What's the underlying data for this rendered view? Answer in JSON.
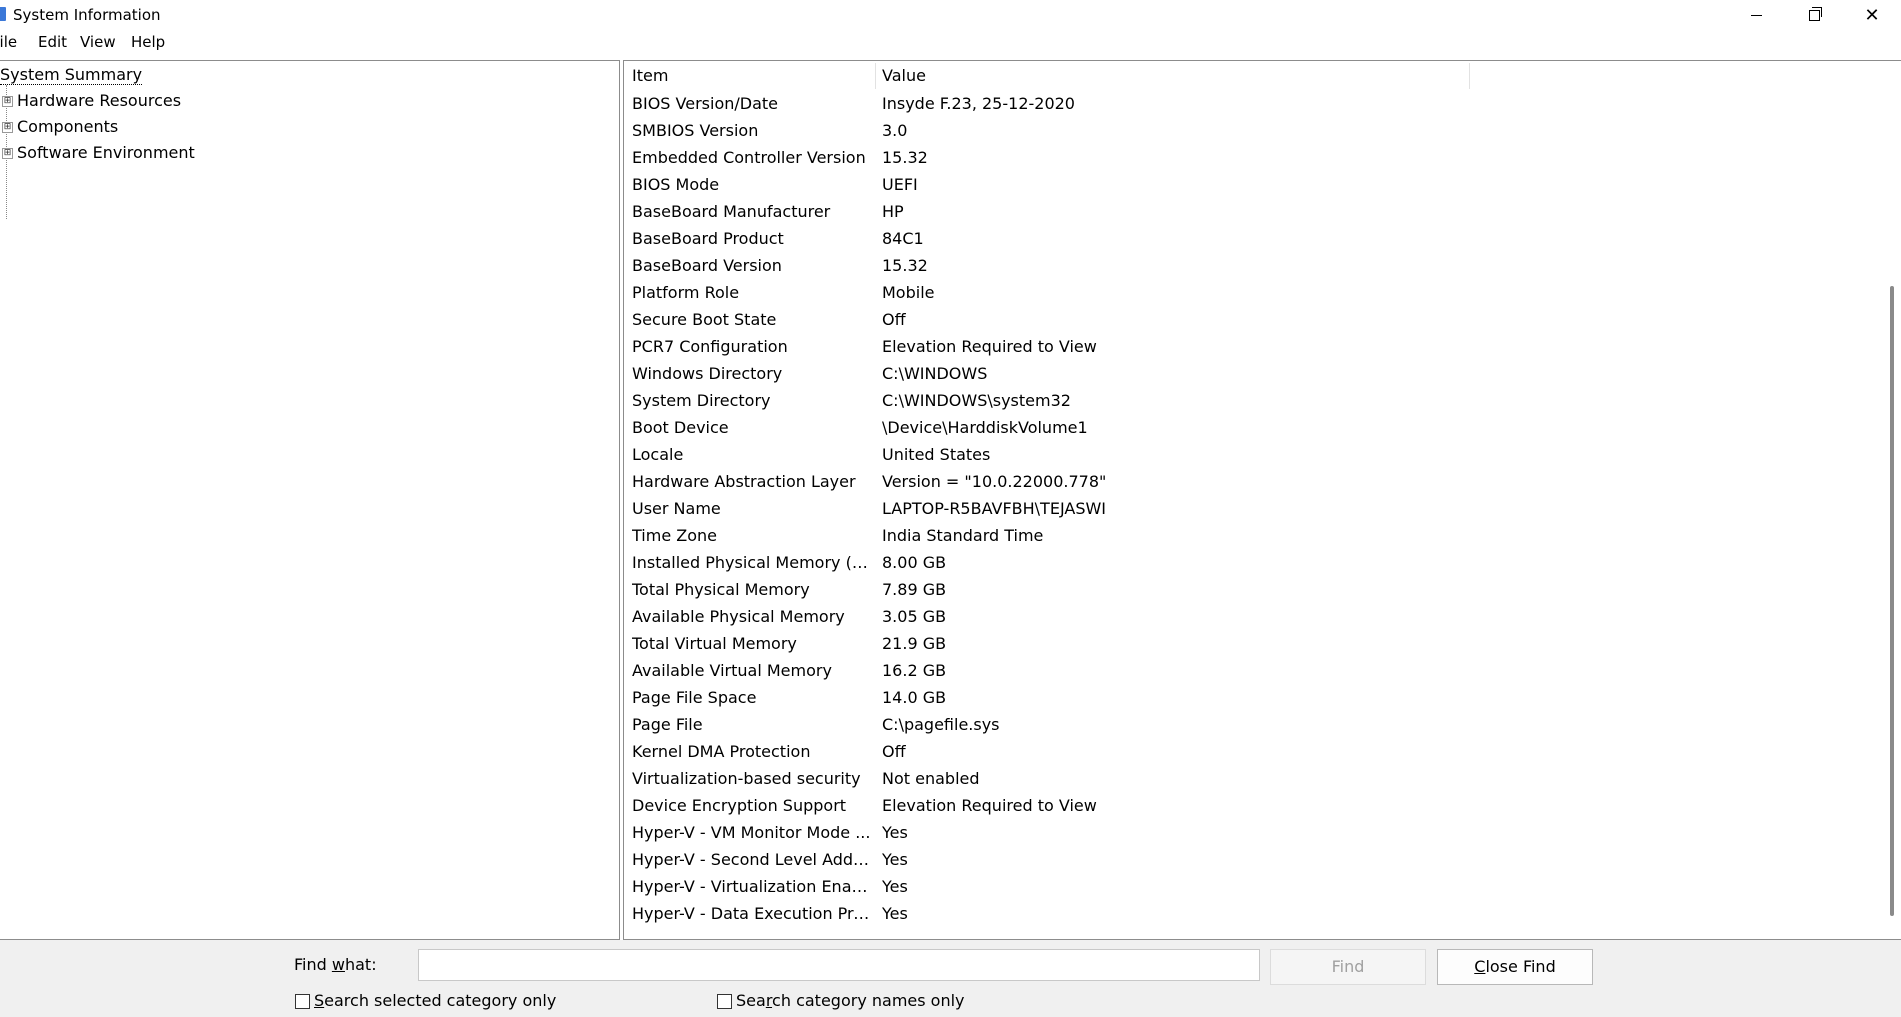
{
  "window": {
    "title": "System Information",
    "icon": "system-information-icon",
    "controls": {
      "minimize": "minimize-icon",
      "maximize": "restore-icon",
      "close_glyph": "✕"
    }
  },
  "menu": {
    "file": "File",
    "edit": "Edit",
    "view": "View",
    "help": "Help"
  },
  "tree": {
    "root": "System Summary",
    "nodes": [
      {
        "label": "Hardware Resources",
        "expander": "⊞"
      },
      {
        "label": "Components",
        "expander": "⊞"
      },
      {
        "label": "Software Environment",
        "expander": "⊞"
      }
    ]
  },
  "list": {
    "columns": {
      "item": "Item",
      "value": "Value"
    },
    "rows": [
      {
        "item": "BIOS Version/Date",
        "value": "Insyde F.23, 25-12-2020"
      },
      {
        "item": "SMBIOS Version",
        "value": "3.0"
      },
      {
        "item": "Embedded Controller Version",
        "value": "15.32"
      },
      {
        "item": "BIOS Mode",
        "value": "UEFI"
      },
      {
        "item": "BaseBoard Manufacturer",
        "value": "HP"
      },
      {
        "item": "BaseBoard Product",
        "value": "84C1"
      },
      {
        "item": "BaseBoard Version",
        "value": "15.32"
      },
      {
        "item": "Platform Role",
        "value": "Mobile"
      },
      {
        "item": "Secure Boot State",
        "value": "Off"
      },
      {
        "item": "PCR7 Configuration",
        "value": "Elevation Required to View"
      },
      {
        "item": "Windows Directory",
        "value": "C:\\WINDOWS"
      },
      {
        "item": "System Directory",
        "value": "C:\\WINDOWS\\system32"
      },
      {
        "item": "Boot Device",
        "value": "\\Device\\HarddiskVolume1"
      },
      {
        "item": "Locale",
        "value": "United States"
      },
      {
        "item": "Hardware Abstraction Layer",
        "value": "Version = \"10.0.22000.778\""
      },
      {
        "item": "User Name",
        "value": "LAPTOP-R5BAVFBH\\TEJASWI"
      },
      {
        "item": "Time Zone",
        "value": "India Standard Time"
      },
      {
        "item": "Installed Physical Memory (RA...",
        "value": "8.00 GB"
      },
      {
        "item": "Total Physical Memory",
        "value": "7.89 GB"
      },
      {
        "item": "Available Physical Memory",
        "value": "3.05 GB"
      },
      {
        "item": "Total Virtual Memory",
        "value": "21.9 GB"
      },
      {
        "item": "Available Virtual Memory",
        "value": "16.2 GB"
      },
      {
        "item": "Page File Space",
        "value": "14.0 GB"
      },
      {
        "item": "Page File",
        "value": "C:\\pagefile.sys"
      },
      {
        "item": "Kernel DMA Protection",
        "value": "Off"
      },
      {
        "item": "Virtualization-based security",
        "value": "Not enabled"
      },
      {
        "item": "Device Encryption Support",
        "value": "Elevation Required to View"
      },
      {
        "item": "Hyper-V - VM Monitor Mode ...",
        "value": "Yes"
      },
      {
        "item": "Hyper-V - Second Level Addre...",
        "value": "Yes"
      },
      {
        "item": "Hyper-V - Virtualization Enabl...",
        "value": "Yes"
      },
      {
        "item": "Hyper-V - Data Execution Pro...",
        "value": "Yes"
      }
    ]
  },
  "find": {
    "label_pre": "Find ",
    "label_accel": "w",
    "label_post": "hat:",
    "input_value": "",
    "find_button": "Find",
    "close_pre": "",
    "close_accel": "C",
    "close_post": "lose Find",
    "chk_selected_accel": "S",
    "chk_selected_rest": "earch selected category only",
    "chk_names_pre": "Sea",
    "chk_names_accel": "r",
    "chk_names_rest": "ch category names only",
    "chk_selected_checked": false,
    "chk_names_checked": false
  }
}
